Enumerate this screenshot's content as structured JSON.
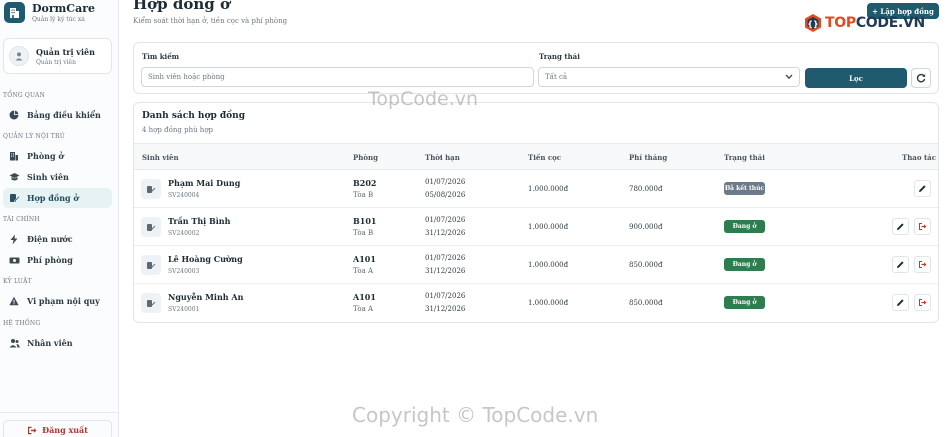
{
  "app": {
    "name": "DormCare",
    "subtitle": "Quản lý ký túc xá"
  },
  "user": {
    "name": "Quản trị viên",
    "role": "Quản trị viên"
  },
  "sidebar": {
    "sections": [
      "TỔNG QUAN",
      "QUẢN LÝ NỘI TRÚ",
      "TÀI CHÍNH",
      "KỶ LUẬT",
      "HỆ THỐNG"
    ],
    "items": [
      {
        "label": "Bảng điều khiển",
        "icon": "pie-chart-icon"
      },
      {
        "label": "Phòng ở",
        "icon": "building-icon"
      },
      {
        "label": "Sinh viên",
        "icon": "graduation-cap-icon"
      },
      {
        "label": "Hợp đồng ở",
        "icon": "contract-icon",
        "active": true
      },
      {
        "label": "Điện nước",
        "icon": "lightning-icon"
      },
      {
        "label": "Phí phòng",
        "icon": "money-icon"
      },
      {
        "label": "Vi phạm nội quy",
        "icon": "warning-icon"
      },
      {
        "label": "Nhân viên",
        "icon": "users-icon"
      }
    ],
    "logout_label": "Đăng xuất"
  },
  "header": {
    "title": "Hợp đồng ở",
    "subtitle": "Kiểm soát thời hạn ở, tiền cọc và phí phòng",
    "add_button": "+ Lập hợp đồng"
  },
  "logo": {
    "part1": "TOP",
    "part2": "CODE.VN"
  },
  "filter": {
    "search_label": "Tìm kiếm",
    "search_placeholder": "Sinh viên hoặc phòng",
    "status_label": "Trạng thái",
    "status_value": "Tất cả",
    "filter_button": "Lọc"
  },
  "table": {
    "title": "Danh sách hợp đồng",
    "count_text": "4 hợp đồng phù hợp",
    "columns": [
      "Sinh viên",
      "Phòng",
      "Thời hạn",
      "Tiền cọc",
      "Phí tháng",
      "Trạng thái",
      "Thao tác"
    ],
    "rows": [
      {
        "name": "Phạm Mai Dung",
        "code": "SV240004",
        "room": "B202",
        "block": "Tòa B",
        "start": "01/07/2026",
        "end": "05/08/2026",
        "deposit": "1.000.000đ",
        "fee": "780.000đ",
        "status": "Đã kết thúc",
        "status_color": "#6c7a89"
      },
      {
        "name": "Trần Thị Bình",
        "code": "SV240002",
        "room": "B101",
        "block": "Tòa B",
        "start": "01/07/2026",
        "end": "31/12/2026",
        "deposit": "1.000.000đ",
        "fee": "900.000đ",
        "status": "Đang ở",
        "status_color": "#2e7d4f"
      },
      {
        "name": "Lê Hoàng Cường",
        "code": "SV240003",
        "room": "A101",
        "block": "Tòa A",
        "start": "01/07/2026",
        "end": "31/12/2026",
        "deposit": "1.000.000đ",
        "fee": "850.000đ",
        "status": "Đang ở",
        "status_color": "#2e7d4f"
      },
      {
        "name": "Nguyễn Minh An",
        "code": "SV240001",
        "room": "A101",
        "block": "Tòa A",
        "start": "01/07/2026",
        "end": "31/12/2026",
        "deposit": "1.000.000đ",
        "fee": "850.000đ",
        "status": "Đang ở",
        "status_color": "#2e7d4f"
      }
    ]
  },
  "watermark": {
    "top": "TopCode.vn",
    "bottom": "Copyright © TopCode.vn"
  },
  "colors": {
    "primary": "#1f5a6e",
    "active_bg": "#e7f2f3",
    "danger": "#c0392b",
    "logo_accent": "#e34a1f"
  }
}
